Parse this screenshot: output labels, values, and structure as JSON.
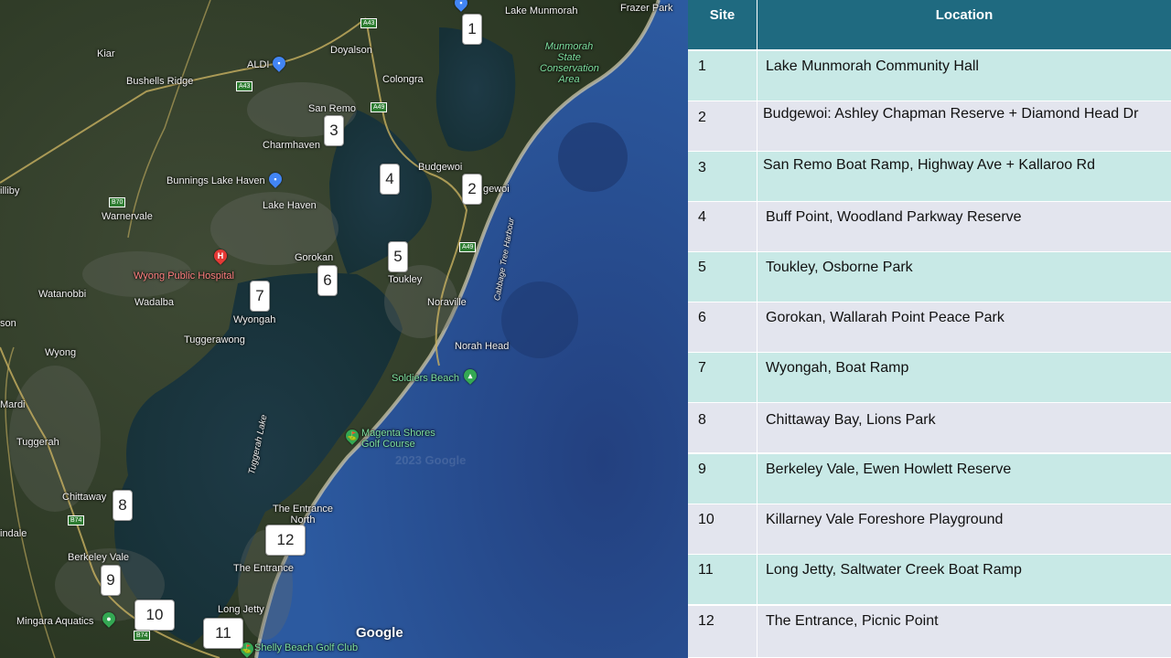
{
  "map": {
    "markers": [
      {
        "id": "1",
        "label": "1"
      },
      {
        "id": "2",
        "label": "2"
      },
      {
        "id": "3",
        "label": "3"
      },
      {
        "id": "4",
        "label": "4"
      },
      {
        "id": "5",
        "label": "5"
      },
      {
        "id": "6",
        "label": "6"
      },
      {
        "id": "7",
        "label": "7"
      },
      {
        "id": "8",
        "label": "8"
      },
      {
        "id": "9",
        "label": "9"
      },
      {
        "id": "10",
        "label": "10"
      },
      {
        "id": "11",
        "label": "11"
      },
      {
        "id": "12",
        "label": "12"
      }
    ],
    "places": {
      "lake_munmorah": "Lake Munmorah",
      "frazer_park": "Frazer Park",
      "munmorah_scr": "Munmorah State Conservation Area",
      "kiar": "Kiar",
      "doyalson": "Doyalson",
      "aldi": "ALDI",
      "colongra": "Colongra",
      "bushells_ridge": "Bushells Ridge",
      "san_remo": "San Remo",
      "charmhaven": "Charmhaven",
      "budgewoi": "Budgewoi",
      "budgewoi_partial": "gewoi",
      "cilliby": "illiby",
      "bunnings": "Bunnings Lake Haven",
      "lake_haven": "Lake Haven",
      "warnervale": "Warnervale",
      "cabbage_tree": "Cabbage Tree Harbour",
      "gorokan": "Gorokan",
      "toukley": "Toukley",
      "wyong_hospital": "Wyong Public Hospital",
      "noraville": "Noraville",
      "watanobbi": "Watanobbi",
      "wadalba": "Wadalba",
      "wyongah": "Wyongah",
      "norah_head": "Norah Head",
      "tuggerawong": "Tuggerawong",
      "wyong": "Wyong",
      "soldiers_beach": "Soldiers Beach",
      "mardi": "Mardi",
      "tuggerah_lake": "Tuggerah Lake",
      "magenta": "Magenta Shores Golf Course",
      "tuggerah": "Tuggerah",
      "chittaway": "Chittaway",
      "the_entrance_north": "The Entrance North",
      "lindale": "indale",
      "berkeley_vale": "Berkeley Vale",
      "the_entrance": "The Entrance",
      "long_jetty": "Long Jetty",
      "mingara": "Mingara Aquatics",
      "shelly_beach": "Shelly Beach Golf Club",
      "son": "son"
    },
    "roads": {
      "a43": "A43",
      "a49": "A49",
      "b70": "B70",
      "b74": "B74"
    },
    "google": "Google",
    "watermark": "2023 Google"
  },
  "table": {
    "header": {
      "site": "Site",
      "location": "Location"
    },
    "rows": [
      {
        "site": "1",
        "location": "Lake Munmorah Community Hall"
      },
      {
        "site": "2",
        "location": "Budgewoi: Ashley Chapman Reserve + Diamond Head Dr"
      },
      {
        "site": "3",
        "location": "San Remo Boat Ramp, Highway Ave + Kallaroo Rd"
      },
      {
        "site": "4",
        "location": "Buff Point, Woodland Parkway Reserve"
      },
      {
        "site": "5",
        "location": "Toukley, Osborne Park"
      },
      {
        "site": "6",
        "location": "Gorokan, Wallarah Point Peace Park"
      },
      {
        "site": "7",
        "location": "Wyongah, Boat Ramp"
      },
      {
        "site": "8",
        "location": "Chittaway Bay, Lions Park"
      },
      {
        "site": "9",
        "location": "Berkeley Vale,  Ewen Howlett Reserve"
      },
      {
        "site": "10",
        "location": "Killarney Vale Foreshore Playground"
      },
      {
        "site": "11",
        "location": "Long Jetty, Saltwater Creek Boat Ramp"
      },
      {
        "site": "12",
        "location": "The Entrance, Picnic Point"
      }
    ]
  },
  "colors": {
    "header_bg": "#1f6a80",
    "row_odd": "#c8e9e6",
    "row_even": "#e3e5ee"
  }
}
